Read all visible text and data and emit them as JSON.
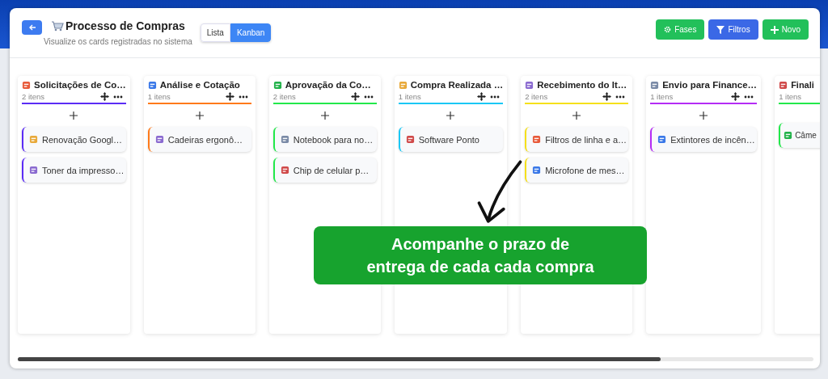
{
  "header": {
    "title": "Processo de Compras",
    "subtitle": "Visualize os cards registradas no sistema",
    "view_toggle": [
      {
        "label": "Lista",
        "selected": false
      },
      {
        "label": "Kanban",
        "selected": true
      }
    ],
    "buttons": [
      {
        "label": "Fases",
        "kind": "gear",
        "color": "#22c05a"
      },
      {
        "label": "Filtros",
        "kind": "filter",
        "color": "#3b68e6"
      },
      {
        "label": "Novo",
        "kind": "plus",
        "color": "#22c05a"
      }
    ]
  },
  "columns": [
    {
      "title": "Solicitações de Co…",
      "count": "2 itens",
      "color": "#5b2cf5",
      "cards": [
        "Renovação Googl…",
        "Toner da impresso…"
      ]
    },
    {
      "title": "Análise e Cotação",
      "count": "1 itens",
      "color": "#ff7a1a",
      "cards": [
        "Cadeiras ergonô…"
      ]
    },
    {
      "title": "Aprovação da Co…",
      "count": "2 itens",
      "color": "#22e84a",
      "cards": [
        "Notebook para no…",
        "Chip de celular p…"
      ]
    },
    {
      "title": "Compra Realizada …",
      "count": "1 itens",
      "color": "#1ac8f5",
      "cards": [
        "Software Ponto"
      ]
    },
    {
      "title": "Recebimento do It…",
      "count": "2 itens",
      "color": "#f5e01a",
      "cards": [
        "Filtros de linha e a…",
        "Microfone de mes…"
      ]
    },
    {
      "title": "Envio para Finance…",
      "count": "1 itens",
      "color": "#b52cf5",
      "cards": [
        "Extintores de incên…"
      ]
    },
    {
      "title": "Finali",
      "count": "1 itens",
      "color": "#22e84a",
      "cards": [
        "Câme"
      ]
    }
  ],
  "callout": {
    "lines": [
      "Acompanhe o prazo de",
      "entrega de cada cada compra"
    ]
  }
}
